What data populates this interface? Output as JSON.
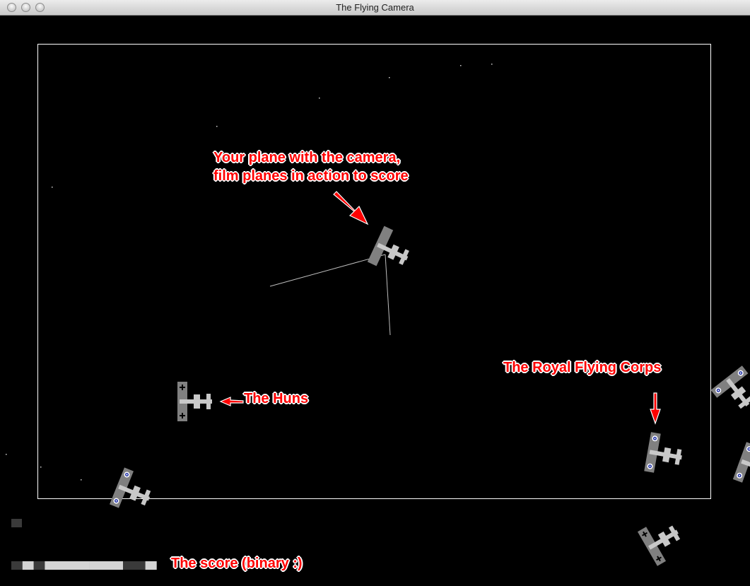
{
  "window": {
    "title": "The Flying Camera"
  },
  "annotations": {
    "camera_line1": "Your plane with the camera,",
    "camera_line2": "film planes in action to score",
    "huns": "The Huns",
    "rfc": "The Royal Flying Corps",
    "score": "The score (binary :)"
  },
  "colors": {
    "background": "#000000",
    "frame": "#ffffff",
    "plane": "#808080",
    "plane_light": "#c8c8c8",
    "annotation": "#ff0000"
  },
  "game": {
    "player": {
      "type": "camera-plane"
    },
    "enemies": [
      {
        "faction": "Huns",
        "marking": "iron-cross"
      },
      {
        "faction": "Huns",
        "marking": "iron-cross"
      }
    ],
    "allies": [
      {
        "faction": "Royal Flying Corps",
        "marking": "roundel"
      },
      {
        "faction": "Royal Flying Corps",
        "marking": "roundel"
      },
      {
        "faction": "Royal Flying Corps",
        "marking": "roundel"
      },
      {
        "faction": "Royal Flying Corps",
        "marking": "roundel"
      }
    ],
    "score_bits": [
      0,
      1,
      0,
      1,
      1,
      1,
      1,
      1,
      1,
      1,
      0,
      0,
      1
    ],
    "lives_indicator": 1
  }
}
